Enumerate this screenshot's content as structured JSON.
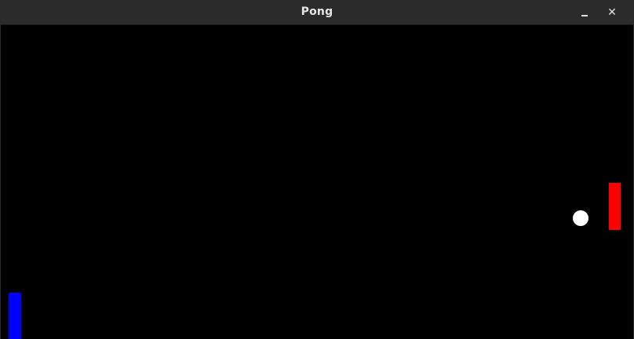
{
  "window": {
    "title": "Pong",
    "minimize_icon": "minimize-icon",
    "close_icon": "close-icon",
    "close_glyph": "✕"
  },
  "game": {
    "background_color": "#000000",
    "left_paddle": {
      "color": "#0000ff"
    },
    "right_paddle": {
      "color": "#ff0000"
    },
    "ball": {
      "color": "#ffffff"
    }
  }
}
